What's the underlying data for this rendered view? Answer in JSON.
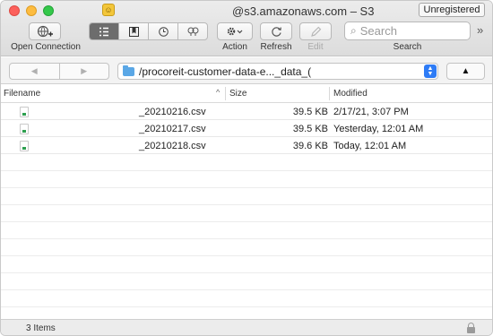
{
  "window": {
    "title": "@s3.amazonaws.com – S3",
    "badge": "Unregistered"
  },
  "toolbar": {
    "open_connection_label": "Open Connection",
    "action_label": "Action",
    "refresh_label": "Refresh",
    "edit_label": "Edit",
    "search_label": "Search",
    "search_placeholder": "Search",
    "overflow_glyph": "»",
    "view_modes": [
      "browser-icon",
      "bookmarks-icon",
      "history-icon",
      "bonjour-icon"
    ],
    "active_view": "browser-icon"
  },
  "pathbar": {
    "back_glyph": "◀",
    "forward_glyph": "▶",
    "path": "/procoreit-customer-data-e..._data_(",
    "up_glyph": "▲"
  },
  "table": {
    "columns": {
      "filename": "Filename",
      "size": "Size",
      "modified": "Modified"
    },
    "sort_indicator": "^",
    "rows": [
      {
        "name": "_20210216.csv",
        "size": "39.5 KB",
        "modified": "2/17/21, 3:07 PM"
      },
      {
        "name": "_20210217.csv",
        "size": "39.5 KB",
        "modified": "Yesterday, 12:01 AM"
      },
      {
        "name": "_20210218.csv",
        "size": "39.6 KB",
        "modified": "Today, 12:01 AM"
      }
    ]
  },
  "status": {
    "item_count": "3 Items"
  },
  "colors": {
    "accent": "#2e7cf6",
    "folder": "#5aa7e6",
    "close": "#fc605b",
    "minimize": "#fdbc40",
    "zoom": "#34c84a"
  }
}
